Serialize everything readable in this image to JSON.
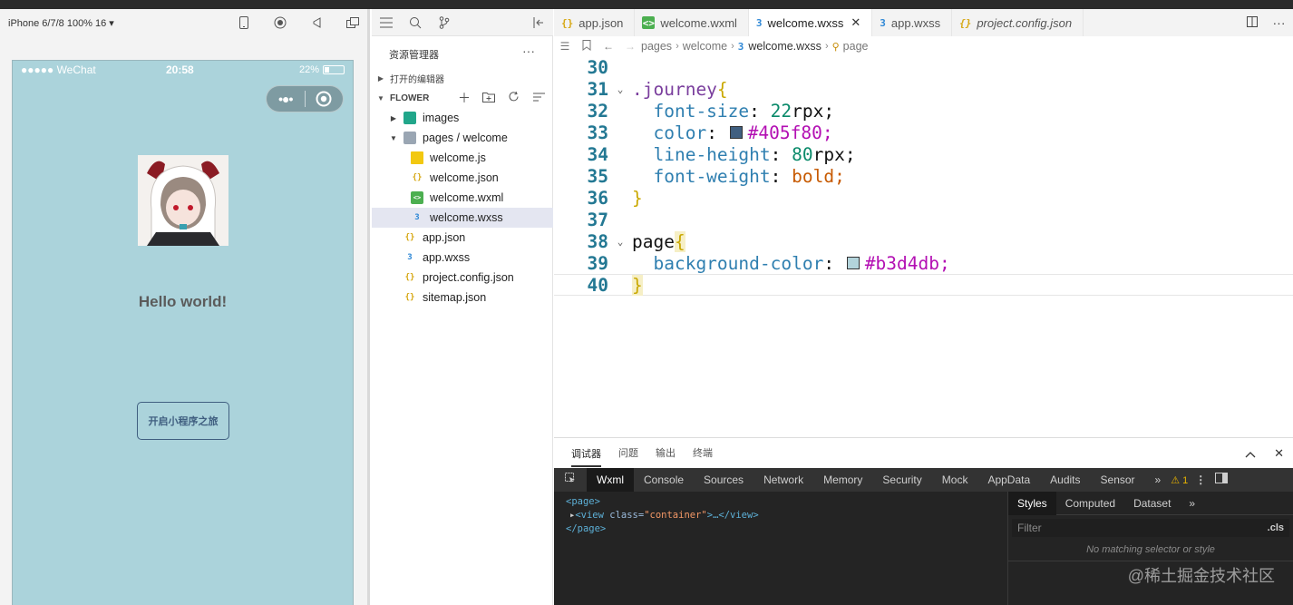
{
  "simulator": {
    "device_label": "iPhone 6/7/8 100% 16 ▾",
    "status": {
      "carrier": "●●●●● WeChat",
      "time": "20:58",
      "battery": "22%"
    },
    "capsule": {
      "dots": "•●•"
    },
    "page": {
      "hello_text": "Hello world!",
      "button_label": "开启小程序之旅",
      "background_color": "#b3d4db",
      "accent_color": "#405f80"
    }
  },
  "explorer": {
    "title": "资源管理器",
    "more": "···",
    "open_editors_label": "打开的编辑器",
    "project_label": "FLOWER",
    "tree": [
      {
        "label": "images",
        "icon": "folder-icon"
      },
      {
        "label": "pages / welcome",
        "icon": "folder-open-icon"
      },
      {
        "label": "welcome.js",
        "icon": "js-file-icon"
      },
      {
        "label": "welcome.json",
        "icon": "json-file-icon"
      },
      {
        "label": "welcome.wxml",
        "icon": "wxml-file-icon"
      },
      {
        "label": "welcome.wxss",
        "icon": "css-file-icon"
      },
      {
        "label": "app.json",
        "icon": "json-file-icon"
      },
      {
        "label": "app.wxss",
        "icon": "css-file-icon"
      },
      {
        "label": "project.config.json",
        "icon": "json-file-icon"
      },
      {
        "label": "sitemap.json",
        "icon": "json-file-icon"
      }
    ]
  },
  "editor": {
    "tabs": [
      {
        "label": "app.json"
      },
      {
        "label": "welcome.wxml"
      },
      {
        "label": "welcome.wxss"
      },
      {
        "label": "app.wxss"
      },
      {
        "label": "project.config.json"
      }
    ],
    "breadcrumb": [
      "pages",
      "welcome",
      "welcome.wxss",
      "page"
    ],
    "lines": {
      "n30": "30",
      "n31": "31",
      "n32": "32",
      "n33": "33",
      "n34": "34",
      "n35": "35",
      "n36": "36",
      "n37": "37",
      "n38": "38",
      "n39": "39",
      "n40": "40"
    },
    "code": {
      "selector1": ".journey",
      "open_brace": "{",
      "close_brace": "}",
      "prop_font_size": "font-size",
      "val_font_size_num": "22",
      "val_font_size_unit": "rpx;",
      "prop_color": "color",
      "val_color": "#405f80;",
      "prop_line_height": "line-height",
      "val_line_height_num": "80",
      "val_line_height_unit": "rpx;",
      "prop_font_weight": "font-weight",
      "val_font_weight": "bold;",
      "selector2": "page",
      "prop_bg": "background-color",
      "val_bg": "#b3d4db;",
      "colon": ": "
    },
    "swatch_colors": {
      "color": "#405f80",
      "bg": "#b3d4db"
    }
  },
  "devtools": {
    "panel_tabs": [
      "调试器",
      "问题",
      "输出",
      "终端"
    ],
    "tools": [
      "Wxml",
      "Console",
      "Sources",
      "Network",
      "Memory",
      "Security",
      "Mock",
      "AppData",
      "Audits",
      "Sensor"
    ],
    "more_tools": "»",
    "warning_count": "⚠ 1",
    "wxml": {
      "page_open": "<page>",
      "view_tag_open": "<view ",
      "view_attr": "class=",
      "view_attr_val": "\"container\"",
      "view_rest": ">…</view>",
      "page_close": "</page>"
    },
    "styles_tabs": [
      "Styles",
      "Computed",
      "Dataset"
    ],
    "filter_placeholder": "Filter",
    "cls_label": ".cls",
    "no_match": "No matching selector or style"
  },
  "watermark": "@稀土掘金技术社区"
}
